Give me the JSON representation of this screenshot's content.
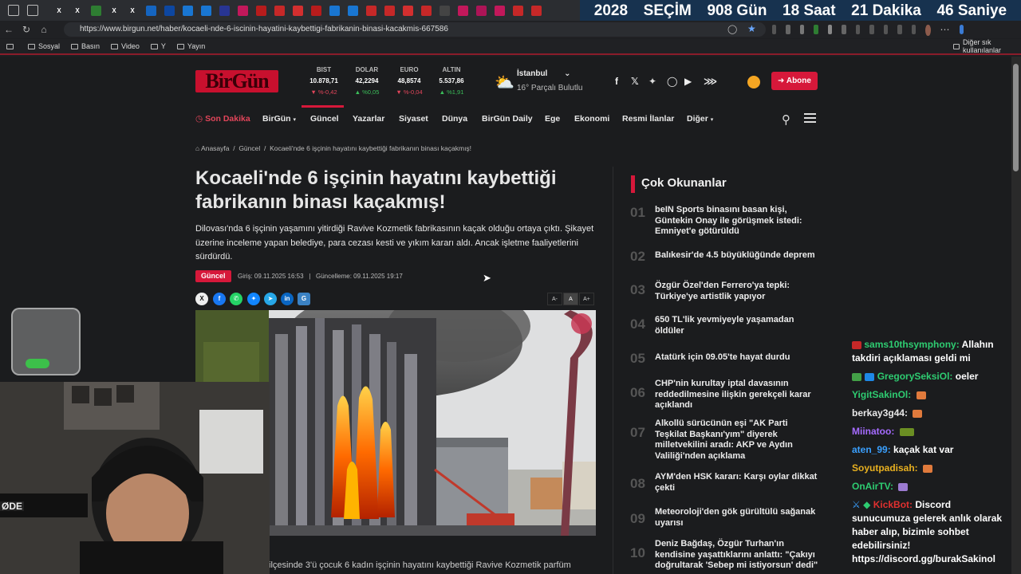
{
  "overlay_timer": {
    "year": "2028",
    "label": "SEÇİM",
    "days": "908 Gün",
    "hours": "18 Saat",
    "minutes": "21 Dakika",
    "seconds": "46 Saniye"
  },
  "browser": {
    "url": "https://www.birgun.net/haber/kocaeli-nde-6-iscinin-hayatini-kaybettigi-fabrikanin-binasi-kacakmis-667586",
    "bookmarks": [
      "Sosyal",
      "Basın",
      "Video",
      "Y",
      "Yayın"
    ],
    "other_bookmarks": "Diğer sık kullanılanlar"
  },
  "site": {
    "logo_text": "BirGün",
    "markets": [
      {
        "name": "BIST",
        "value": "10.878,71",
        "change": "%-0,42",
        "dir": "down"
      },
      {
        "name": "DOLAR",
        "value": "42,2294",
        "change": "%0,05",
        "dir": "up"
      },
      {
        "name": "EURO",
        "value": "48,8574",
        "change": "%-0,04",
        "dir": "down"
      },
      {
        "name": "ALTIN",
        "value": "5.537,86",
        "change": "%1,91",
        "dir": "up"
      }
    ],
    "weather": {
      "city": "İstanbul",
      "desc": "16° Parçalı Bulutlu"
    },
    "subscribe_label": "Abone",
    "nav": [
      "Son Dakika",
      "BirGün",
      "Güncel",
      "Yazarlar",
      "Siyaset",
      "Dünya",
      "BirGün Daily",
      "Ege",
      "Ekonomi",
      "Resmi İlanlar",
      "Diğer"
    ]
  },
  "article": {
    "breadcrumb": [
      "Anasayfa",
      "Güncel",
      "Kocaeli'nde 6 işçinin hayatını kaybettiği fabrikanın binası kaçakmış!"
    ],
    "title": "Kocaeli'nde 6 işçinin hayatını kaybettiği fabrikanın binası kaçakmış!",
    "summary": "Dilovası'nda 6 işçinin yaşamını yitirdiği Ravive Kozmetik fabrikasının kaçak olduğu ortaya çıktı. Şikayet üzerine inceleme yapan belediye, para cezası kesti ve yıkım kararı aldı. Ancak işletme faaliyetlerini sürdürdü.",
    "category": "Güncel",
    "published": "Giriş: 09.11.2025 16:53",
    "updated": "Güncelleme: 09.11.2025 19:17",
    "font_controls": [
      "A-",
      "A",
      "A+"
    ],
    "body_start": "ilçesinde 3'ü çocuk 6 kadın işçinin hayatını kaybettiği Ravive Kozmetik parfüm"
  },
  "popular": {
    "title": "Çok Okunanlar",
    "items": [
      {
        "num": "01",
        "text": "beIN Sports binasını basan kişi, Güntekin Onay ile görüşmek istedi: Emniyet'e götürüldü"
      },
      {
        "num": "02",
        "text": "Balıkesir'de 4.5 büyüklüğünde deprem"
      },
      {
        "num": "03",
        "text": "Özgür Özel'den Ferrero'ya tepki: Türkiye'ye artistlik yapıyor"
      },
      {
        "num": "04",
        "text": "650 TL'lik yevmiyeyle yaşamadan öldüler"
      },
      {
        "num": "05",
        "text": "Atatürk için 09.05'te hayat durdu"
      },
      {
        "num": "06",
        "text": "CHP'nin kurultay iptal davasının reddedilmesine ilişkin gerekçeli karar açıklandı"
      },
      {
        "num": "07",
        "text": "Alkollü sürücünün eşi \"AK Parti Teşkilat Başkanı'yım\" diyerek milletvekilini aradı: AKP ve Aydın Valiliği'nden açıklama"
      },
      {
        "num": "08",
        "text": "AYM'den HSK kararı: Karşı oylar dikkat çekti"
      },
      {
        "num": "09",
        "text": "Meteoroloji'den gök gürültülü sağanak uyarısı"
      },
      {
        "num": "10",
        "text": "Deniz Bağdaş, Özgür Turhan'ın kendisine yaşattıklarını anlattı: \"Çakıyı doğrultarak 'Sebep mi istiyorsun' dedi\""
      }
    ]
  },
  "chat": [
    {
      "user": "sams10thsymphony:",
      "color": "#2ecc71",
      "msg": "Allahın takdiri açıklaması geldi mi"
    },
    {
      "user": "GregorySeksiOl:",
      "color": "#2ecc71",
      "msg": "oeler"
    },
    {
      "user": "YigitSakinOl:",
      "color": "#2ecc71",
      "msg": ""
    },
    {
      "user": "berkay3g44:",
      "color": "#e8e8e8",
      "msg": ""
    },
    {
      "user": "Miinatoo:",
      "color": "#a56bff",
      "msg": ""
    },
    {
      "user": "aten_99:",
      "color": "#3aa0ff",
      "msg": "kaçak kat var"
    },
    {
      "user": "Soyutpadisah:",
      "color": "#e8b020",
      "msg": ""
    },
    {
      "user": "OnAirTV:",
      "color": "#2ecc71",
      "msg": ""
    },
    {
      "user": "KickBot:",
      "color": "#e0302f",
      "msg": "Discord sunucumuza gelerek anlık olarak haber alıp, bizimle sohbet edebilirsiniz! https://discord.gg/burakSakinol"
    }
  ],
  "colors": {
    "accent": "#d6183a",
    "timer_bg": "#17324f"
  }
}
